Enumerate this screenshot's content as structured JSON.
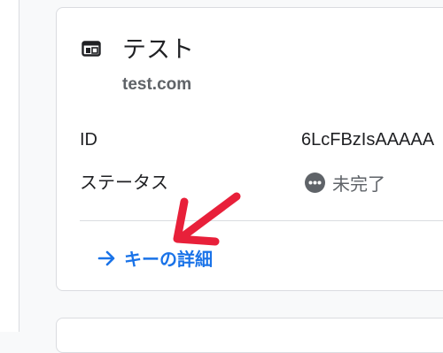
{
  "card": {
    "title": "テスト",
    "title_icon": "web-window-icon",
    "domain": "test.com",
    "rows": [
      {
        "label": "ID",
        "value": "6LcFBzIsAAAAA"
      },
      {
        "label": "ステータス",
        "value": "未完了",
        "icon": "more-horiz-icon"
      }
    ],
    "link_label": "キーの詳細",
    "link_icon": "arrow-right-icon"
  },
  "annotation": {
    "icon": "red-pointer-arrow-icon",
    "color": "#e8203a"
  },
  "colors": {
    "link": "#1a73e8",
    "border": "#dadce0",
    "muted": "#5f6368"
  }
}
